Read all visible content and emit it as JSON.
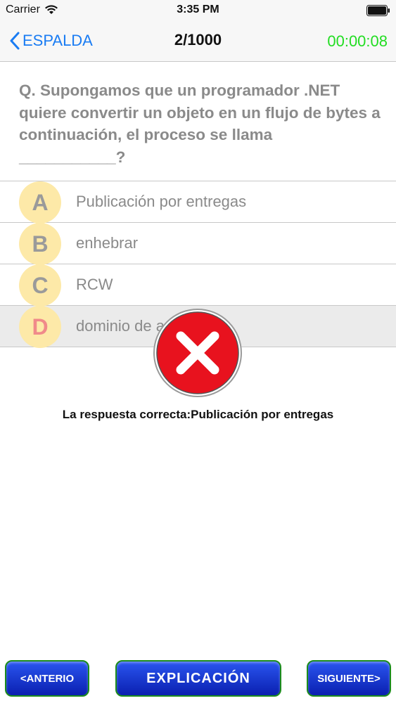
{
  "status_bar": {
    "carrier": "Carrier",
    "time": "3:35 PM"
  },
  "nav": {
    "back_label": "ESPALDA",
    "counter": "2/1000",
    "timer": "00:00:08"
  },
  "question": {
    "text": "Q. Supongamos que un programador .NET quiere convertir un objeto en un flujo de bytes a continuación, el proceso se llama ___________?"
  },
  "options": [
    {
      "letter": "A",
      "text": "Publicación por entregas"
    },
    {
      "letter": "B",
      "text": "enhebrar"
    },
    {
      "letter": "C",
      "text": "RCW"
    },
    {
      "letter": "D",
      "text": "dominio de aplicación"
    }
  ],
  "result": {
    "icon": "wrong-x-icon",
    "correct_answer_text": "La respuesta correcta:Publicación por entregas"
  },
  "footer": {
    "prev_label": "<ANTERIO",
    "explain_label": "EXPLICACIÓN",
    "next_label": "SIGUIENTE>"
  },
  "colors": {
    "accent_blue": "#1a7cf3",
    "timer_green": "#22dd22",
    "option_circle": "#fde9a8",
    "wrong_red": "#e8121e",
    "button_blue": "#0a1fb0",
    "button_border": "#1c8c1c"
  }
}
